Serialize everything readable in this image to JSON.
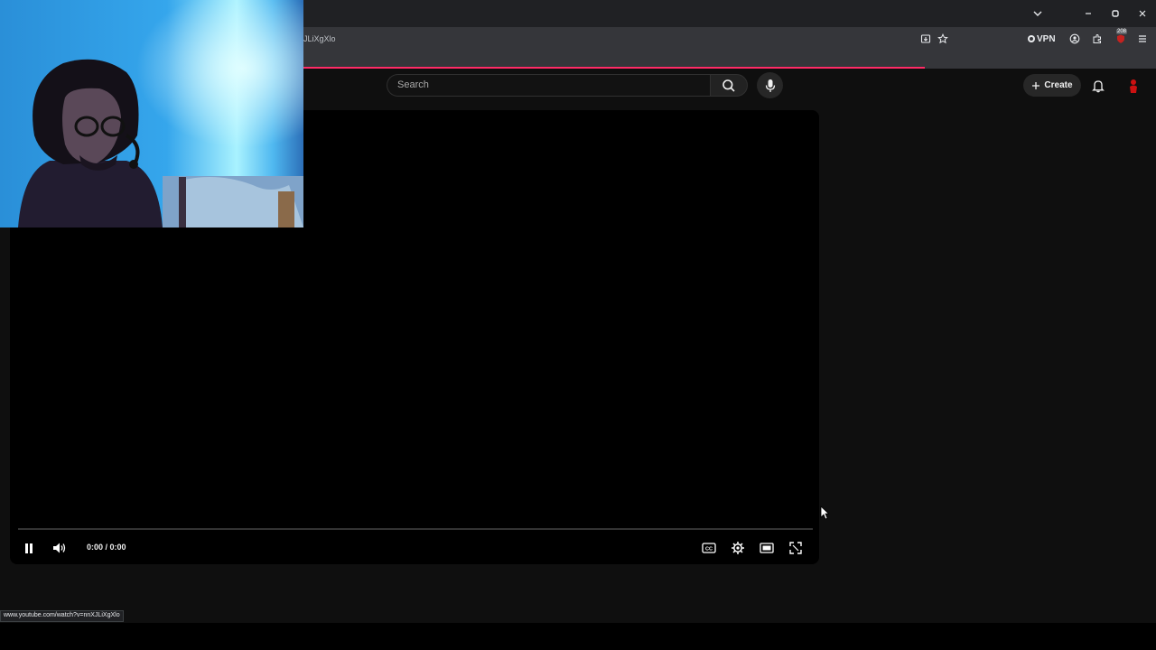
{
  "browser": {
    "url_fragment": "JLiXgXlo",
    "vpn_label": "VPN",
    "extension_badge": "208",
    "status_url": "www.youtube.com/watch?v=nnXJLiXgXlo",
    "loading_progress": 0.69,
    "icons": [
      "chevron-down-icon",
      "minimize-icon",
      "restore-icon",
      "close-icon",
      "install-icon",
      "star-icon",
      "account-icon",
      "extensions-icon",
      "menu-icon"
    ]
  },
  "header": {
    "search_placeholder": "Search",
    "create_label": "Create",
    "icons": [
      "search-icon",
      "mic-icon",
      "plus-icon",
      "bell-icon",
      "avatar-icon"
    ]
  },
  "player": {
    "time": "0:00 / 0:00",
    "progress": 0,
    "icons": [
      "pause-icon",
      "volume-icon",
      "captions-icon",
      "settings-icon",
      "theater-icon",
      "fullscreen-icon"
    ]
  },
  "colors": {
    "accent": "#ff2b66",
    "background": "#0f0f0f",
    "player_bg": "#000000"
  }
}
